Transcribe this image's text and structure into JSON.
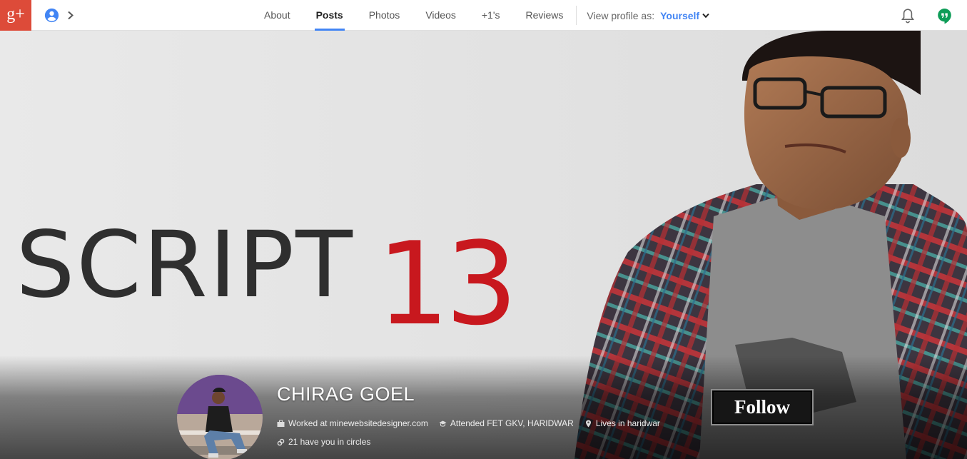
{
  "brand": {
    "logo_text": "g+",
    "color": "#dd4b39"
  },
  "account": {
    "icon": "account-circle-icon",
    "expand_icon": "chevron-right-icon"
  },
  "nav": {
    "tabs": [
      {
        "label": "About"
      },
      {
        "label": "Posts",
        "active": true
      },
      {
        "label": "Photos"
      },
      {
        "label": "Videos"
      },
      {
        "label": "+1's"
      },
      {
        "label": "Reviews"
      }
    ],
    "view_as_label": "View profile as:",
    "view_as_value": "Yourself",
    "accent": "#4285f4"
  },
  "header_right": {
    "notifications_icon": "bell-icon",
    "hangouts_icon": "hangouts-icon"
  },
  "cover": {
    "logo_word": "SCRIPT",
    "logo_number": "13",
    "logo_number_color": "#c8181e"
  },
  "profile": {
    "name": "CHIRAG GOEL",
    "work": "Worked at minewebsitedesigner.com",
    "education": "Attended FET GKV, HARIDWAR",
    "location": "Lives in haridwar",
    "circles": "21 have you in circles",
    "follow_label": "Follow"
  }
}
